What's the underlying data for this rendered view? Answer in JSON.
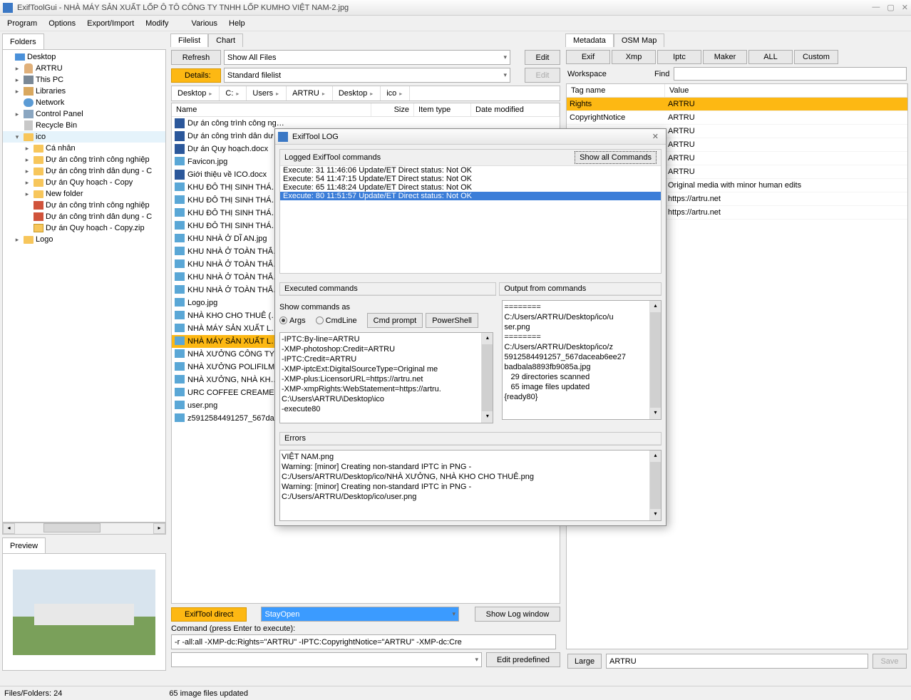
{
  "window": {
    "title": "ExifToolGui - NHÀ MÁY SẢN XUẤT LỐP Ô TÔ CÔNG TY TNHH LỐP KUMHO VIỆT NAM-2.jpg"
  },
  "menubar": [
    "Program",
    "Options",
    "Export/Import",
    "Modify",
    "Various",
    "Help"
  ],
  "left": {
    "tab": "Folders",
    "tree": [
      {
        "t": "Desktop",
        "lvl": 0,
        "exp": "",
        "icon": "ic-tree-desktop"
      },
      {
        "t": "ARTRU",
        "lvl": 1,
        "exp": "▸",
        "icon": "ic-user"
      },
      {
        "t": "This PC",
        "lvl": 1,
        "exp": "▸",
        "icon": "ic-pc"
      },
      {
        "t": "Libraries",
        "lvl": 1,
        "exp": "▸",
        "icon": "ic-lib"
      },
      {
        "t": "Network",
        "lvl": 1,
        "exp": "",
        "icon": "ic-net"
      },
      {
        "t": "Control Panel",
        "lvl": 1,
        "exp": "▸",
        "icon": "ic-cpl"
      },
      {
        "t": "Recycle Bin",
        "lvl": 1,
        "exp": "",
        "icon": "ic-bin"
      },
      {
        "t": "ico",
        "lvl": 1,
        "exp": "▾",
        "icon": "ic-folder",
        "sel": true
      },
      {
        "t": "Cá nhân",
        "lvl": 2,
        "exp": "▸",
        "icon": "ic-folder"
      },
      {
        "t": "Dự án công trình công nghiệp",
        "lvl": 2,
        "exp": "▸",
        "icon": "ic-folder"
      },
      {
        "t": "Dự án công trình dân dụng - C",
        "lvl": 2,
        "exp": "▸",
        "icon": "ic-folder"
      },
      {
        "t": "Dự án Quy hoạch - Copy",
        "lvl": 2,
        "exp": "▸",
        "icon": "ic-folder"
      },
      {
        "t": "New folder",
        "lvl": 2,
        "exp": "▸",
        "icon": "ic-folder"
      },
      {
        "t": "Dự án công trình công nghiệp",
        "lvl": 2,
        "exp": "",
        "icon": "ic-red"
      },
      {
        "t": "Dự án công trình dân dụng - C",
        "lvl": 2,
        "exp": "",
        "icon": "ic-red"
      },
      {
        "t": "Dự án Quy hoạch - Copy.zip",
        "lvl": 2,
        "exp": "",
        "icon": "ic-zip"
      },
      {
        "t": "Logo",
        "lvl": 1,
        "exp": "▸",
        "icon": "ic-folder"
      }
    ],
    "preview_tab": "Preview"
  },
  "mid": {
    "tabs": [
      "Filelist",
      "Chart"
    ],
    "refresh": "Refresh",
    "show_files": "Show All Files",
    "edit": "Edit",
    "details": "Details:",
    "std_filelist": "Standard filelist",
    "edit2": "Edit",
    "crumbs": [
      "Desktop",
      "C:",
      "Users",
      "ARTRU",
      "Desktop",
      "ico"
    ],
    "cols": {
      "name": "Name",
      "size": "Size",
      "type": "Item type",
      "date": "Date modified"
    },
    "files": [
      {
        "n": "Dự án công trình công ng…",
        "i": "ic-word"
      },
      {
        "n": "Dự án công trình dân dư…",
        "i": "ic-word"
      },
      {
        "n": "Dự án Quy hoạch.docx",
        "i": "ic-word"
      },
      {
        "n": "Favicon.jpg",
        "i": "ic-img"
      },
      {
        "n": "Giới thiệu về ICO.docx",
        "i": "ic-word"
      },
      {
        "n": "KHU ĐÔ THỊ SINH THÁ…",
        "i": "ic-img"
      },
      {
        "n": "KHU ĐÔ THỊ SINH THÁ…",
        "i": "ic-img"
      },
      {
        "n": "KHU ĐÔ THỊ SINH THÁ…",
        "i": "ic-img"
      },
      {
        "n": "KHU ĐÔ THỊ SINH THÁ…",
        "i": "ic-img"
      },
      {
        "n": "KHU NHÀ Ở DĨ AN.jpg",
        "i": "ic-img"
      },
      {
        "n": "KHU NHÀ Ở TOÀN THẮ…",
        "i": "ic-img"
      },
      {
        "n": "KHU NHÀ Ở TOÀN THẮ…",
        "i": "ic-img"
      },
      {
        "n": "KHU NHÀ Ở TOÀN THẮ…",
        "i": "ic-img"
      },
      {
        "n": "KHU NHÀ Ở TOÀN THẮ…",
        "i": "ic-img"
      },
      {
        "n": "Logo.jpg",
        "i": "ic-img"
      },
      {
        "n": "NHÀ KHO CHO THUÊ (…",
        "i": "ic-img"
      },
      {
        "n": "NHÀ MÁY SẢN XUẤT L…",
        "i": "ic-img"
      },
      {
        "n": "NHÀ MÁY SẢN XUẤT L…",
        "i": "ic-img",
        "sel": true
      },
      {
        "n": "NHÀ XƯỞNG CÔNG TY…",
        "i": "ic-img"
      },
      {
        "n": "NHÀ XƯỞNG POLIFILM…",
        "i": "ic-img"
      },
      {
        "n": "NHÀ XƯỞNG, NHÀ KH…",
        "i": "ic-img"
      },
      {
        "n": "URC COFFEE CREAMER…",
        "i": "ic-img"
      },
      {
        "n": "user.png",
        "i": "ic-png"
      },
      {
        "n": "z5912584491257_567dac…",
        "i": "ic-img"
      }
    ],
    "et_direct": "ExifTool direct",
    "stayopen": "StayOpen",
    "show_log": "Show Log window",
    "cmd_label": "Command (press Enter to execute):",
    "cmd_value": "-r -all:all -XMP-dc:Rights=\"ARTRU\" -IPTC:CopyrightNotice=\"ARTRU\" -XMP-dc:Cre",
    "edit_predef": "Edit predefined"
  },
  "right": {
    "tabs": [
      "Metadata",
      "OSM Map"
    ],
    "btns": [
      "Exif",
      "Xmp",
      "Iptc",
      "Maker",
      "ALL",
      "Custom"
    ],
    "workspace": "Workspace",
    "find": "Find",
    "head": {
      "k": "Tag name",
      "v": "Value"
    },
    "rows": [
      {
        "k": "Rights",
        "v": "ARTRU",
        "sel": true
      },
      {
        "k": "CopyrightNotice",
        "v": "ARTRU"
      },
      {
        "k": "",
        "v": "ARTRU"
      },
      {
        "k": "",
        "v": "ARTRU"
      },
      {
        "k": "",
        "v": "ARTRU"
      },
      {
        "k": "",
        "v": "ARTRU"
      },
      {
        "k": "",
        "v": "Original media with minor human edits"
      },
      {
        "k": "",
        "v": "https://artru.net"
      },
      {
        "k": "",
        "v": "https://artru.net"
      }
    ],
    "large": "Large",
    "large_val": "ARTRU",
    "save": "Save"
  },
  "dialog": {
    "title": "ExifTool LOG",
    "logged_label": "Logged ExifTool commands",
    "show_all": "Show all Commands",
    "lines": [
      "Execute: 31 11:46:06 Update/ET Direct status: Not OK",
      "Execute: 54 11:47:15 Update/ET Direct status: Not OK",
      "Execute: 65 11:48:24 Update/ET Direct status: Not OK",
      "Execute: 80 11:51:57 Update/ET Direct status: Not OK"
    ],
    "exec_label": "Executed commands",
    "out_label": "Output from commands",
    "show_as": "Show commands as",
    "args": "Args",
    "cmdline": "CmdLine",
    "cmd_prompt": "Cmd prompt",
    "powershell": "PowerShell",
    "exec_body": "-IPTC:By-line=ARTRU\n-XMP-photoshop:Credit=ARTRU\n-IPTC:Credit=ARTRU\n-XMP-iptcExt:DigitalSourceType=Original me\n-XMP-plus:LicensorURL=https://artru.net\n-XMP-xmpRights:WebStatement=https://artru.\nC:\\Users\\ARTRU\\Desktop\\ico\n-execute80",
    "out_body": "========\nC:/Users/ARTRU/Desktop/ico/u\nser.png\n========\nC:/Users/ARTRU/Desktop/ico/z\n5912584491257_567daceab6ee27\nbadbala8893fb9085a.jpg\n   29 directories scanned\n   65 image files updated\n{ready80}",
    "errors_label": "Errors",
    "errors_body": "VIỆT NAM.png\nWarning: [minor] Creating non-standard IPTC in PNG -\nC:/Users/ARTRU/Desktop/ico/NHÀ XƯỞNG, NHÀ KHO CHO THUÊ.png\nWarning: [minor] Creating non-standard IPTC in PNG -\nC:/Users/ARTRU/Desktop/ico/user.png"
  },
  "status": {
    "left": "Files/Folders: 24",
    "mid": "65 image files updated"
  }
}
